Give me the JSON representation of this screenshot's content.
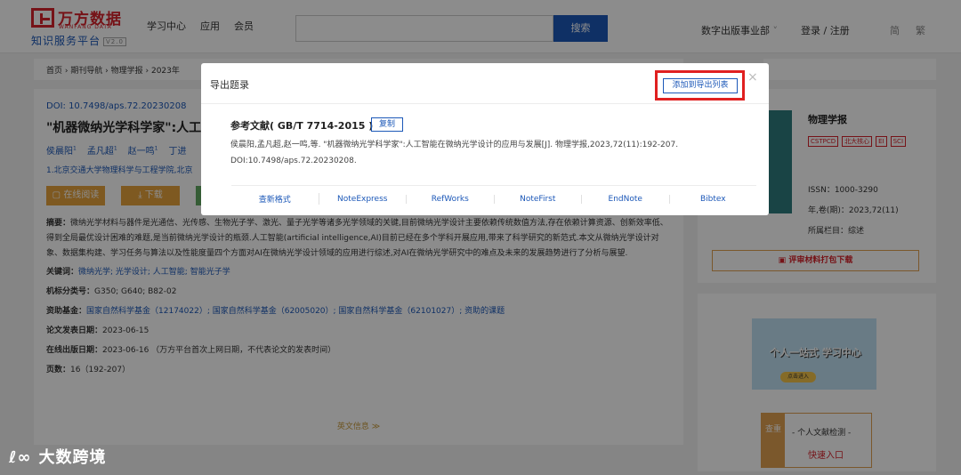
{
  "header": {
    "logo_cn": "万方数据",
    "logo_en": "WANFANG DATA",
    "logo_sub": "知识服务平台",
    "logo_ver": "V2.0",
    "nav": [
      "学习中心",
      "应用",
      "会员"
    ],
    "search_button": "搜索",
    "publishing": "数字出版事业部",
    "login": "登录 / 注册",
    "lang_simplified": "简",
    "lang_traditional": "繁"
  },
  "breadcrumb": "首页 › 期刊导航 › 物理学报 › 2023年",
  "article": {
    "doi": "DOI: 10.7498/aps.72.20230208",
    "title": "\"机器微纳光学科学家\":人工智",
    "authors": [
      {
        "name": "侯晨阳",
        "sup": "1"
      },
      {
        "name": "孟凡超",
        "sup": "1"
      },
      {
        "name": "赵一鸣",
        "sup": "1"
      },
      {
        "name": "丁进",
        "sup": ""
      }
    ],
    "affiliation": "1.北京交通大学物理科学与工程学院,北京",
    "actions": [
      "在线阅读",
      "下载"
    ],
    "abstract_label": "摘要：",
    "abstract": "微纳光学材料与器件是光通信、光传感、生物光子学、激光、量子光学等诸多光学领域的关键,目前微纳光学设计主要依赖传统数值方法,存在依赖计算资源、创新效率低、得到全局最优设计困难的难题,是当前微纳光学设计的瓶颈.人工智能(artificial intelligence,AI)目前已经在多个学科开展应用,带来了科学研究的新范式.本文从微纳光学设计对象、数据集构建、学习任务与算法以及性能度量四个方面对AI在微纳光学设计领域的应用进行综述,对AI在微纳光学研究中的难点及未来的发展趋势进行了分析与展望.",
    "keywords_label": "关键词：",
    "keywords": "微纳光学; 光学设计; 人工智能; 智能光子学",
    "class_label": "机标分类号：",
    "class_value": "G350; G640; B82-02",
    "fund_label": "资助基金：",
    "fund_value": "国家自然科学基金（12174022）; 国家自然科学基金（62005020）; 国家自然科学基金（62101027）; 资助的课题",
    "pubdate_label": "论文发表日期：",
    "pubdate_value": "2023-06-15",
    "online_label": "在线出版日期：",
    "online_value": "2023-06-16  （万方平台首次上网日期，不代表论文的发表时间）",
    "pages_label": "页数：",
    "pages_value": "16（192-207）",
    "more_english": "英文信息 ≫"
  },
  "journal": {
    "name": "物理学报",
    "tags": [
      "CSTPCD",
      "北大核心",
      "EI",
      "SCI"
    ],
    "issn": "ISSN：1000-3290",
    "year_issue": "年,卷(期)：2023,72(11)",
    "column": "所属栏目：综述",
    "review_button": "评审材料打包下载"
  },
  "promo": {
    "banner_title": "个人一站式 学习中心",
    "banner_sub": "点击进入",
    "check_side": "查重",
    "check_title": "- 个人文献检测 -",
    "check_link": "快速入口"
  },
  "modal": {
    "title": "导出题录",
    "add_button": "添加到导出列表",
    "close": "×",
    "ref_label": "参考文献( GB/T 7714-2015 )",
    "copy_button": "复制",
    "citation": "侯晨阳,孟凡超,赵一鸣,等. \"机器微纳光学科学家\":人工智能在微纳光学设计的应用与发展[J]. 物理学报,2023,72(11):192-207. DOI:10.7498/aps.72.20230208.",
    "formats": [
      "查新格式",
      "NoteExpress",
      "RefWorks",
      "NoteFirst",
      "EndNote",
      "Bibtex"
    ]
  },
  "watermark": {
    "logo": "ℓ∞",
    "text": "大数跨境"
  },
  "colors": {
    "brand_red": "#d7232c",
    "link_blue": "#1c58b8",
    "highlight_red": "#e02020",
    "overlay": "rgba(0,0,0,0.45)"
  }
}
